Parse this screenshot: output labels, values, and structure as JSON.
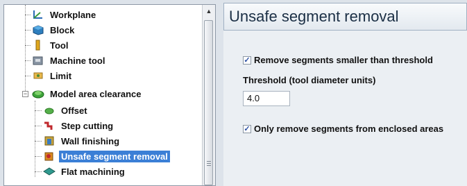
{
  "tree": {
    "items": [
      {
        "label": "Workplane",
        "icon": "workplane-icon"
      },
      {
        "label": "Block",
        "icon": "block-icon"
      },
      {
        "label": "Tool",
        "icon": "tool-icon"
      },
      {
        "label": "Machine tool",
        "icon": "machine-tool-icon"
      },
      {
        "label": "Limit",
        "icon": "limit-icon"
      },
      {
        "label": "Model area clearance",
        "icon": "model-area-clearance-icon",
        "expander": "−"
      },
      {
        "label": "Offset",
        "icon": "offset-icon"
      },
      {
        "label": "Step cutting",
        "icon": "step-cutting-icon"
      },
      {
        "label": "Wall finishing",
        "icon": "wall-finishing-icon"
      },
      {
        "label": "Unsafe segment removal",
        "icon": "unsafe-segment-removal-icon",
        "selected": true
      },
      {
        "label": "Flat machining",
        "icon": "flat-machining-icon"
      }
    ],
    "scroll_up_glyph": "▲"
  },
  "panel": {
    "title": "Unsafe segment removal",
    "remove_segments": {
      "label": "Remove segments smaller than threshold",
      "checked": true
    },
    "threshold": {
      "label": "Threshold (tool diameter units)",
      "value": "4.0"
    },
    "only_enclosed": {
      "label": "Only remove segments from enclosed areas",
      "checked": true
    }
  },
  "colors": {
    "selection": "#3b7fd6",
    "header_text": "#1b2f45"
  }
}
